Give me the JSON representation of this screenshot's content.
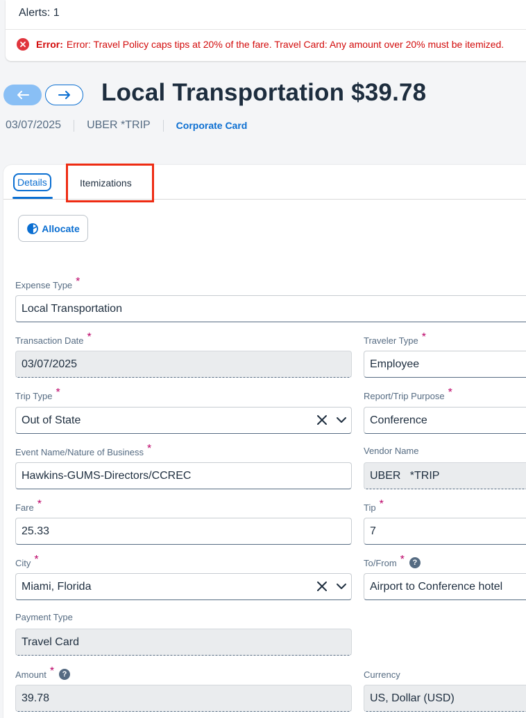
{
  "alerts": {
    "title": "Alerts: 1",
    "error_label": "Error:",
    "error_text": "Error: Travel Policy caps tips at 20% of the fare. Travel Card: Any amount over 20% must be itemized."
  },
  "header": {
    "title": "Local Transportation $39.78",
    "date": "03/07/2025",
    "vendor": "UBER *TRIP",
    "payment": "Corporate Card"
  },
  "tabs": {
    "details": "Details",
    "itemizations": "Itemizations"
  },
  "allocate_label": "Allocate",
  "fields": {
    "expense_type": {
      "label": "Expense Type",
      "value": "Local Transportation"
    },
    "transaction_date": {
      "label": "Transaction Date",
      "value": "03/07/2025"
    },
    "traveler_type": {
      "label": "Traveler Type",
      "value": "Employee"
    },
    "trip_type": {
      "label": "Trip Type",
      "value": "Out of State"
    },
    "report_purpose": {
      "label": "Report/Trip Purpose",
      "value": "Conference"
    },
    "event_name": {
      "label": "Event Name/Nature of Business",
      "value": "Hawkins-GUMS-Directors/CCREC"
    },
    "vendor_name": {
      "label": "Vendor Name",
      "value": "UBER   *TRIP"
    },
    "fare": {
      "label": "Fare",
      "value": "25.33"
    },
    "tip": {
      "label": "Tip",
      "value": "7"
    },
    "city": {
      "label": "City",
      "value": "Miami, Florida"
    },
    "to_from": {
      "label": "To/From",
      "value": "Airport to Conference hotel"
    },
    "payment_type": {
      "label": "Payment Type",
      "value": "Travel Card"
    },
    "amount": {
      "label": "Amount",
      "value": "39.78"
    },
    "currency": {
      "label": "Currency",
      "value": "US, Dollar (USD)"
    }
  },
  "required_mark": "*",
  "help_mark": "?",
  "colors": {
    "accent": "#0a6ed1",
    "error": "#d20a0a",
    "required": "#bb0066",
    "highlight": "#ee2b12"
  }
}
